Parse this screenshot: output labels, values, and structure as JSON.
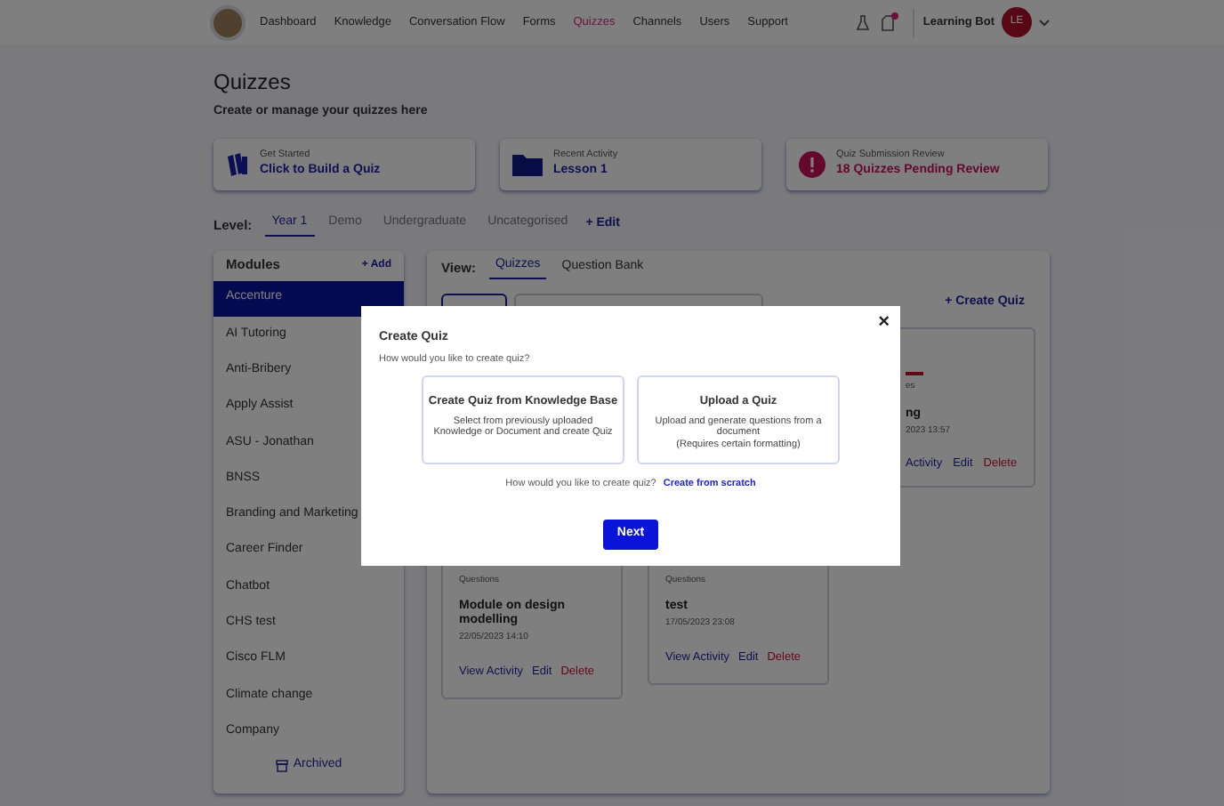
{
  "nav": {
    "items": [
      {
        "label": "Dashboard",
        "selected": false
      },
      {
        "label": "Knowledge",
        "selected": false
      },
      {
        "label": "Conversation Flow",
        "selected": false
      },
      {
        "label": "Forms",
        "selected": false
      },
      {
        "label": "Quizzes",
        "selected": true
      },
      {
        "label": "Channels",
        "selected": false
      },
      {
        "label": "Users",
        "selected": false
      },
      {
        "label": "Support",
        "selected": false
      }
    ],
    "notification_dot": true,
    "user_name": "Learning Bot",
    "avatar_initials": "LE"
  },
  "page": {
    "title": "Quizzes",
    "subtitle": "Create or manage your quizzes here"
  },
  "summary_cards": [
    {
      "kind": "books",
      "label": "Get Started",
      "value": "Click to Build a Quiz"
    },
    {
      "kind": "folder",
      "label": "Recent Activity",
      "value": "Lesson 1"
    },
    {
      "kind": "alert",
      "label": "Quiz Submission Review",
      "value": "18 Quizzes Pending Review"
    }
  ],
  "level": {
    "label": "Level:",
    "tabs": [
      {
        "label": "Year 1",
        "selected": true
      },
      {
        "label": "Demo",
        "selected": false
      },
      {
        "label": "Undergraduate",
        "selected": false
      },
      {
        "label": "Uncategorised",
        "selected": false
      }
    ],
    "edit": "+ Edit"
  },
  "modules": {
    "title": "Modules",
    "add": "+ Add",
    "items": [
      {
        "label": "Accenture",
        "selected": true
      },
      {
        "label": "AI Tutoring",
        "selected": false
      },
      {
        "label": "Anti-Bribery",
        "selected": false
      },
      {
        "label": "Apply Assist",
        "selected": false
      },
      {
        "label": "ASU - Jonathan",
        "selected": false
      },
      {
        "label": "BNSS",
        "selected": false
      },
      {
        "label": "Branding and Marketing",
        "selected": false
      },
      {
        "label": "Career Finder",
        "selected": false
      },
      {
        "label": "Chatbot",
        "selected": false
      },
      {
        "label": "CHS test",
        "selected": false
      },
      {
        "label": "Cisco FLM",
        "selected": false
      },
      {
        "label": "Climate change",
        "selected": false
      },
      {
        "label": "Company",
        "selected": false
      }
    ],
    "archived": "Archived"
  },
  "view": {
    "label": "View:",
    "tabs": [
      {
        "label": "Quizzes",
        "selected": true
      },
      {
        "label": "Question Bank",
        "selected": false
      }
    ],
    "create": "+ Create Quiz"
  },
  "partial_card": {
    "label": "es",
    "title": "ng",
    "date": "2023 13:57",
    "actions": [
      "Activity",
      "Edit",
      "Delete"
    ]
  },
  "quiz_cards": [
    {
      "label": "Questions",
      "title": "Module on design modelling",
      "date": "22/05/2023 14:10",
      "actions": [
        "View Activity",
        "Edit",
        "Delete"
      ]
    },
    {
      "label": "Questions",
      "title": "test",
      "date": "17/05/2023 23:08",
      "actions": [
        "View Activity",
        "Edit",
        "Delete"
      ]
    }
  ],
  "dialog": {
    "title": "Create Quiz",
    "prompt": "How would you like to create quiz?",
    "options": [
      {
        "title": "Create Quiz from Knowledge Base",
        "description": "Select from previously uploaded Knowledge or Document and create Quiz"
      },
      {
        "title": "Upload a Quiz",
        "description": "Upload and generate questions from a document\n(Requires certain formatting)"
      }
    ],
    "footer_prompt": "How would you like to create quiz?",
    "footer_link": "Create from scratch",
    "next": "Next",
    "close": "×"
  }
}
